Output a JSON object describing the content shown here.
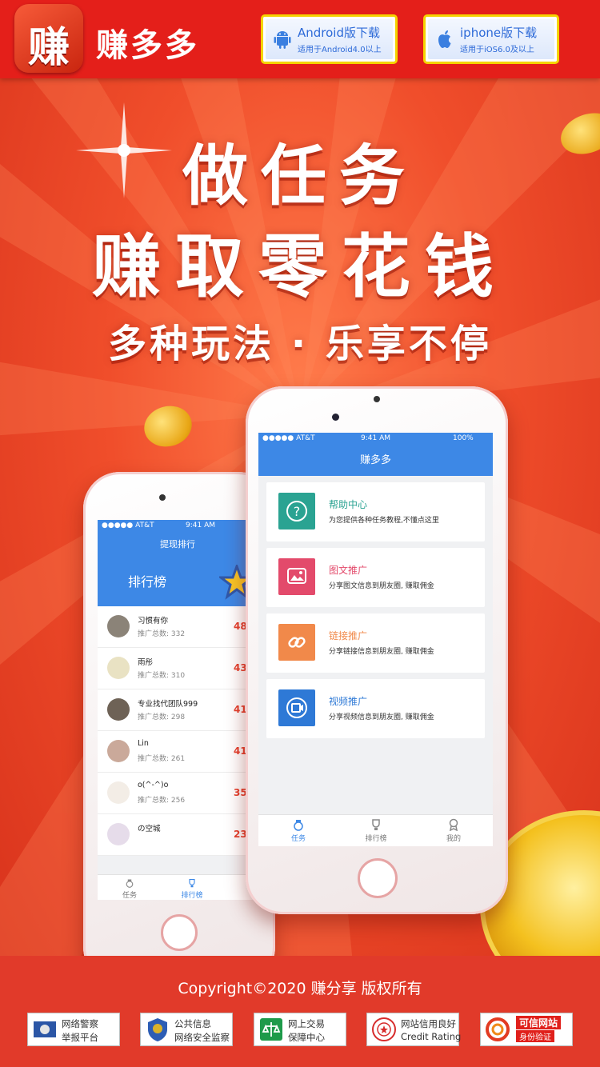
{
  "header": {
    "logo_char": "赚",
    "app_name": "赚多多",
    "android": {
      "title": "Android版下载",
      "subtitle": "适用于Android4.0以上"
    },
    "ios": {
      "title": "iphone版下载",
      "subtitle": "适用于iOS6.0及以上"
    }
  },
  "hero": {
    "line1": "做任务",
    "line2": "赚取零花钱",
    "line3": "多种玩法 · 乐享不停"
  },
  "front_phone": {
    "status": {
      "carrier": "●●●●● AT&T",
      "time": "9:41 AM",
      "battery": "100%"
    },
    "title": "赚多多",
    "tasks": [
      {
        "title": "帮助中心",
        "desc": "为您提供各种任务教程,不懂点这里",
        "color": "#2aa392",
        "icon": "question-icon"
      },
      {
        "title": "图文推广",
        "desc": "分享图文信息到朋友圈, 赚取佣金",
        "color": "#e34a6b",
        "icon": "image-icon"
      },
      {
        "title": "链接推广",
        "desc": "分享链接信息到朋友圈, 赚取佣金",
        "color": "#f1894a",
        "icon": "link-icon"
      },
      {
        "title": "视频推广",
        "desc": "分享视频信息到朋友圈, 赚取佣金",
        "color": "#2e79d6",
        "icon": "video-icon"
      }
    ],
    "tabs": [
      "任务",
      "排行榜",
      "我的"
    ]
  },
  "back_phone": {
    "status": {
      "carrier": "●●●●● AT&T",
      "time": "9:41 AM"
    },
    "title": "提现排行",
    "banner": "排行榜",
    "rows": [
      {
        "name": "习惯有你",
        "count": "推广总数:  332",
        "score": "488"
      },
      {
        "name": "雨彤",
        "count": "推广总数:  310",
        "score": "433"
      },
      {
        "name": "专业找代团队999",
        "count": "推广总数:  298",
        "score": "412"
      },
      {
        "name": "Lin",
        "count": "推广总数:  261",
        "score": "410"
      },
      {
        "name": "o(^-^)o",
        "count": "推广总数:  256",
        "score": "353"
      },
      {
        "name": "の空城",
        "count": "",
        "score": "231"
      }
    ],
    "tabs": [
      "任务",
      "排行榜"
    ]
  },
  "footer": {
    "copyright": "Copyright©2020 赚分享 版权所有",
    "badges": [
      {
        "l1": "网络警察",
        "l2": "举报平台"
      },
      {
        "l1": "公共信息",
        "l2": "网络安全监察"
      },
      {
        "l1": "网上交易",
        "l2": "保障中心"
      },
      {
        "l1": "网站信用良好",
        "l2": "Credit Rating"
      },
      {
        "l1": "可信网站",
        "l2": "身份验证"
      }
    ]
  },
  "colors": {
    "header_red": "#e41f1a",
    "accent_yellow": "#f5d300",
    "app_blue": "#3d88e6",
    "footer_red": "#e13a2a"
  }
}
